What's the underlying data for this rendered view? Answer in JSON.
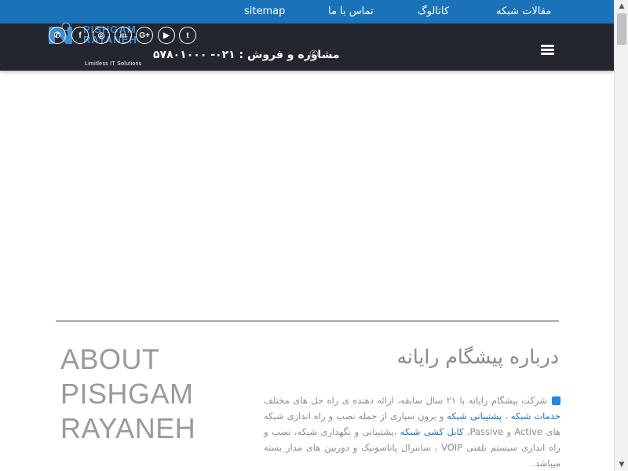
{
  "topbar": {
    "links": [
      "مقالات شبکه",
      "کاتالوگ",
      "تماس با ما",
      "sitemap"
    ]
  },
  "header": {
    "logo": {
      "line1": "PISHGAM",
      "line2": "RAYANEH",
      "tagline": "Limitless IT Solutions"
    },
    "socials": [
      {
        "icon": "whatsapp-icon",
        "glyph": "✆"
      },
      {
        "icon": "facebook-icon",
        "glyph": "f"
      },
      {
        "icon": "instagram-icon",
        "glyph": "◎"
      },
      {
        "icon": "linkedin-icon",
        "glyph": "in"
      },
      {
        "icon": "google-plus-icon",
        "glyph": "G+"
      },
      {
        "icon": "youtube-icon",
        "glyph": "▶"
      },
      {
        "icon": "twitter-icon",
        "glyph": "t"
      }
    ],
    "phone_label": "مشاوره و فروش : ۰۲۱- ۵۷۸۰۱۰۰۰",
    "phone_icon": "phone-icon",
    "menu_icon": "hamburger-menu-icon"
  },
  "about": {
    "title_en": "ABOUT PISHGAM RAYANEH",
    "title_fa": "درباره پیشگام رایانه",
    "para_intro": "شرکت پیشگام رایانه با ۲۱ سال سابقه، ارائه دهنده ی راه حل های مختلف ",
    "link1": "خدمات شبکه",
    "sep1": " ، ",
    "link2": "پشتیبانی شبکه",
    "para_mid": " و برون سپاری از جمله نصب و راه اندازی شبکه های Active و Passive، ",
    "link3": "کابل کشی شبکه",
    "para_end": " ،پشتیبانی و نگهداری شبکه، نصب و راه اندازی سیستم تلفنی VOIP ، سانترال پاناسونیک و دوربین های مدار بسته میباشد."
  },
  "colors": {
    "topbar": "#1a73b8",
    "header": "#23262f",
    "accent": "#1e88e5",
    "heading_gray": "#9a9a9a"
  }
}
